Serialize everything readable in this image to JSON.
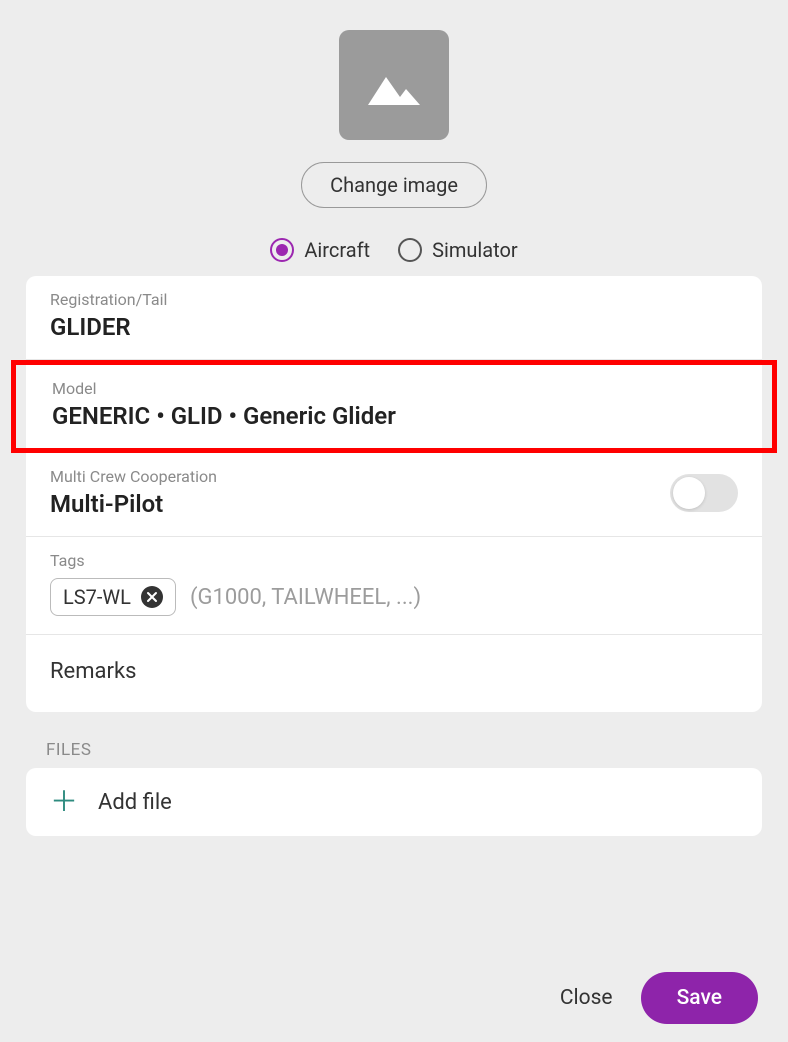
{
  "image": {
    "change_button": "Change image"
  },
  "type_selector": {
    "aircraft": "Aircraft",
    "simulator": "Simulator",
    "selected": "aircraft"
  },
  "fields": {
    "registration": {
      "label": "Registration/Tail",
      "value": "GLIDER"
    },
    "model": {
      "label": "Model",
      "value": "GENERIC • GLID • Generic Glider"
    },
    "mcc": {
      "label": "Multi Crew Cooperation",
      "value": "Multi-Pilot",
      "enabled": false
    },
    "tags": {
      "label": "Tags",
      "items": [
        "LS7-WL"
      ],
      "placeholder": "(G1000, TAILWHEEL, ...)"
    },
    "remarks": {
      "label": "Remarks"
    }
  },
  "files": {
    "header": "FILES",
    "add_label": "Add file"
  },
  "footer": {
    "close": "Close",
    "save": "Save"
  }
}
